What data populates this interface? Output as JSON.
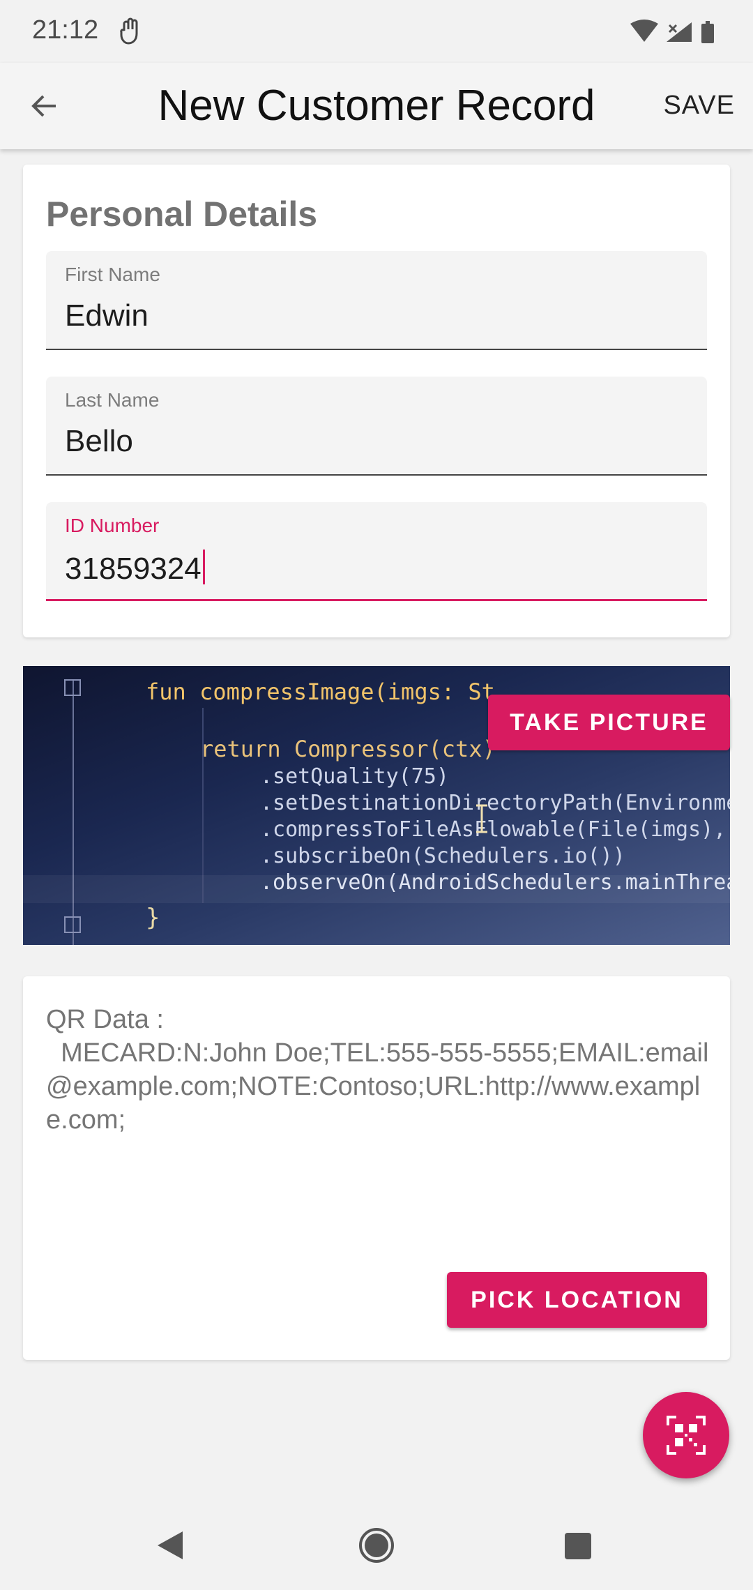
{
  "status_bar": {
    "time": "21:12"
  },
  "app_bar": {
    "title": "New Customer Record",
    "save_label": "SAVE"
  },
  "personal": {
    "section_title": "Personal Details",
    "fields": [
      {
        "label": "First Name",
        "value": "Edwin"
      },
      {
        "label": "Last Name",
        "value": "Bello"
      },
      {
        "label": "ID Number",
        "value": "31859324"
      }
    ]
  },
  "photo": {
    "button_label": "TAKE PICTURE",
    "code_lines": [
      "fun compressImage(imgs: St",
      "return Compressor(ctx)",
      ".setQuality(75)",
      ".setDestinationDirectoryPath(Environment.g",
      ".compressToFileAsFlowable(File(imgs),  com",
      ".subscribeOn(Schedulers.io())",
      ".observeOn(AndroidSchedulers.mainThread())",
      "}"
    ]
  },
  "qr": {
    "text": "QR Data :\n  MECARD:N:John Doe;TEL:555-555-5555;EMAIL:email@example.com;NOTE:Contoso;URL:http://www.example.com;",
    "pick_location_label": "PICK LOCATION"
  },
  "colors": {
    "accent": "#d81b60",
    "background": "#f2f2f2"
  },
  "icons": {
    "back": "arrow-back-icon",
    "fab": "qr-scan-icon",
    "nav": [
      "nav-back-icon",
      "nav-home-icon",
      "nav-recents-icon"
    ]
  }
}
